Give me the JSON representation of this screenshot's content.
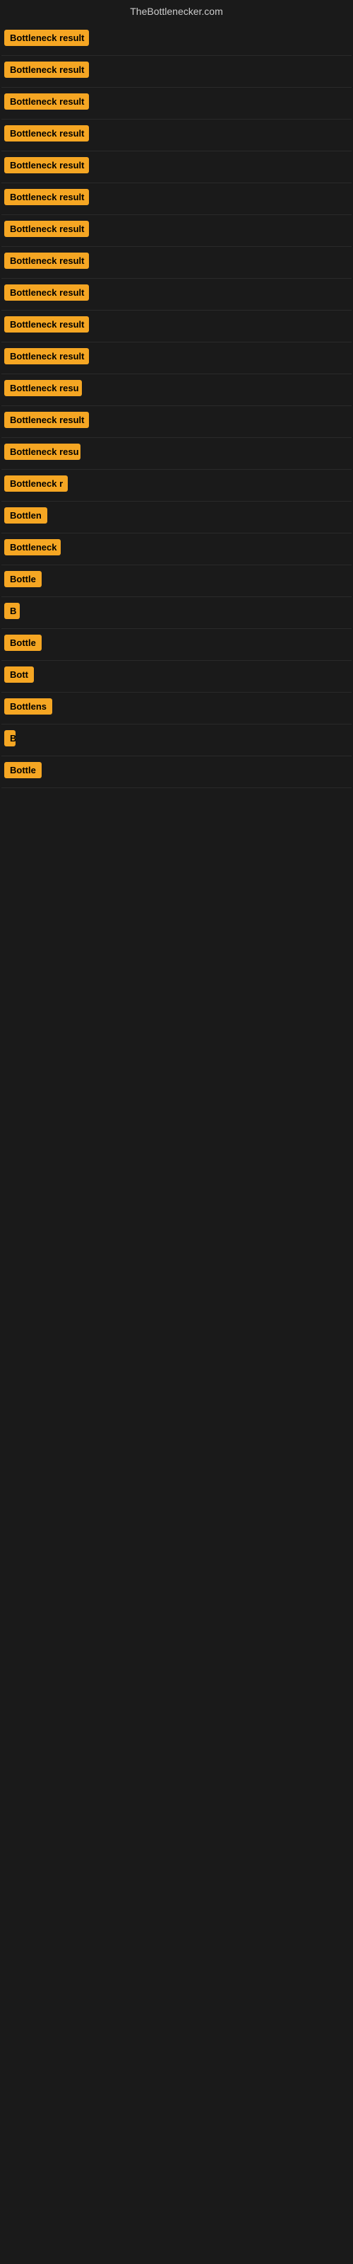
{
  "site": {
    "title": "TheBottlenecker.com"
  },
  "items": [
    {
      "id": 1,
      "label": "Bottleneck result",
      "badge_width": 120
    },
    {
      "id": 2,
      "label": "Bottleneck result",
      "badge_width": 120
    },
    {
      "id": 3,
      "label": "Bottleneck result",
      "badge_width": 120
    },
    {
      "id": 4,
      "label": "Bottleneck result",
      "badge_width": 120
    },
    {
      "id": 5,
      "label": "Bottleneck result",
      "badge_width": 120
    },
    {
      "id": 6,
      "label": "Bottleneck result",
      "badge_width": 120
    },
    {
      "id": 7,
      "label": "Bottleneck result",
      "badge_width": 120
    },
    {
      "id": 8,
      "label": "Bottleneck result",
      "badge_width": 120
    },
    {
      "id": 9,
      "label": "Bottleneck result",
      "badge_width": 120
    },
    {
      "id": 10,
      "label": "Bottleneck result",
      "badge_width": 120
    },
    {
      "id": 11,
      "label": "Bottleneck result",
      "badge_width": 120
    },
    {
      "id": 12,
      "label": "Bottleneck resu",
      "badge_width": 110
    },
    {
      "id": 13,
      "label": "Bottleneck result",
      "badge_width": 120
    },
    {
      "id": 14,
      "label": "Bottleneck resu",
      "badge_width": 108
    },
    {
      "id": 15,
      "label": "Bottleneck r",
      "badge_width": 90
    },
    {
      "id": 16,
      "label": "Bottlen",
      "badge_width": 68
    },
    {
      "id": 17,
      "label": "Bottleneck",
      "badge_width": 80
    },
    {
      "id": 18,
      "label": "Bottle",
      "badge_width": 58
    },
    {
      "id": 19,
      "label": "B",
      "badge_width": 22
    },
    {
      "id": 20,
      "label": "Bottle",
      "badge_width": 58
    },
    {
      "id": 21,
      "label": "Bott",
      "badge_width": 45
    },
    {
      "id": 22,
      "label": "Bottlens",
      "badge_width": 68
    },
    {
      "id": 23,
      "label": "B",
      "badge_width": 16
    },
    {
      "id": 24,
      "label": "Bottle",
      "badge_width": 54
    }
  ]
}
